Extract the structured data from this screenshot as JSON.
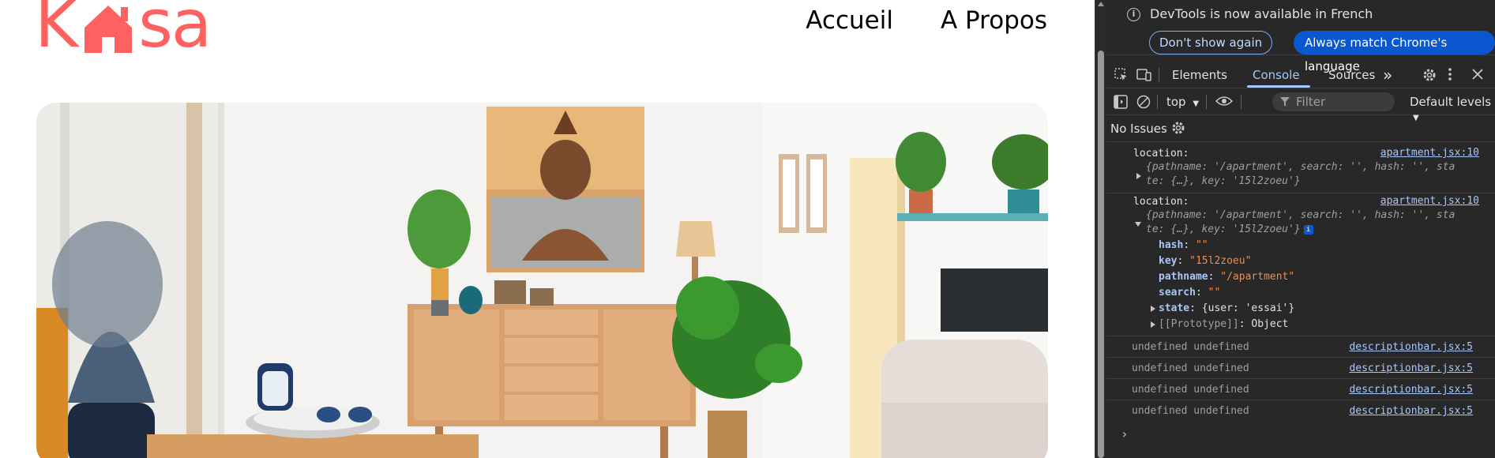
{
  "site": {
    "logo": {
      "left": "K",
      "right": "sa"
    },
    "nav": {
      "home": "Accueil",
      "about": "A Propos"
    },
    "colors": {
      "brand": "#ff6060"
    }
  },
  "devtools": {
    "infobar": {
      "message": "DevTools is now available in French",
      "dont_show": "Don't show again",
      "always_match": "Always match Chrome's language"
    },
    "tabs": {
      "elements": "Elements",
      "console": "Console",
      "sources": "Sources",
      "more": "»"
    },
    "toolbar": {
      "context": "top",
      "filter_placeholder": "Filter",
      "levels": "Default levels"
    },
    "issues": "No Issues",
    "console": {
      "entry1": {
        "label": "location:",
        "source": "apartment.jsx:10",
        "summary_a": "{pathname: '/apartment', search: '', hash: '', sta",
        "summary_b": "te: {…}, key: '15l2zoeu'}"
      },
      "entry2": {
        "label": "location:",
        "source": "apartment.jsx:10",
        "summary_a": "{pathname: '/apartment', search: '', hash: '', sta",
        "summary_b": "te: {…}, key: '15l2zoeu'}",
        "props": [
          {
            "key": "hash",
            "value": "\"\""
          },
          {
            "key": "key",
            "value": "\"15l2zoeu\""
          },
          {
            "key": "pathname",
            "value": "\"/apartment\""
          },
          {
            "key": "search",
            "value": "\"\""
          }
        ],
        "state_key": "state",
        "state_value": "{user: 'essai'}",
        "proto_key": "[[Prototype]]",
        "proto_value": "Object"
      },
      "undefined_rows": [
        {
          "text": "undefined undefined",
          "source": "descriptionbar.jsx:5"
        },
        {
          "text": "undefined undefined",
          "source": "descriptionbar.jsx:5"
        },
        {
          "text": "undefined undefined",
          "source": "descriptionbar.jsx:5"
        },
        {
          "text": "undefined undefined",
          "source": "descriptionbar.jsx:5"
        }
      ],
      "prompt": "›"
    }
  }
}
